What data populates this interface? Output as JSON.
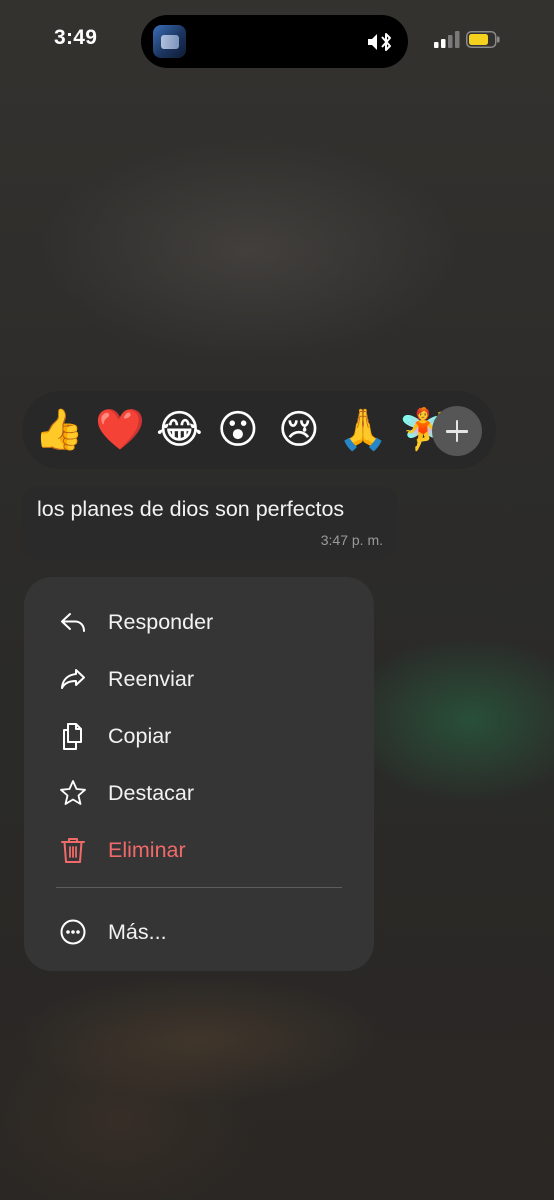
{
  "status_bar": {
    "time": "3:49",
    "battery_color": "#f4d21f"
  },
  "reactions": {
    "emojis": [
      "👍",
      "❤️",
      "😂",
      "😮",
      "😢",
      "🙏",
      "🧚"
    ],
    "more_icon": "plus-icon"
  },
  "message": {
    "text": "los planes de dios son perfectos",
    "time": "3:47 p. m."
  },
  "menu": {
    "items": [
      {
        "label": "Responder",
        "icon": "reply-icon"
      },
      {
        "label": "Reenviar",
        "icon": "forward-icon"
      },
      {
        "label": "Copiar",
        "icon": "copy-icon"
      },
      {
        "label": "Destacar",
        "icon": "star-icon"
      },
      {
        "label": "Eliminar",
        "icon": "trash-icon",
        "color": "#f06a6a"
      },
      {
        "label": "Más...",
        "icon": "more-icon"
      }
    ]
  }
}
